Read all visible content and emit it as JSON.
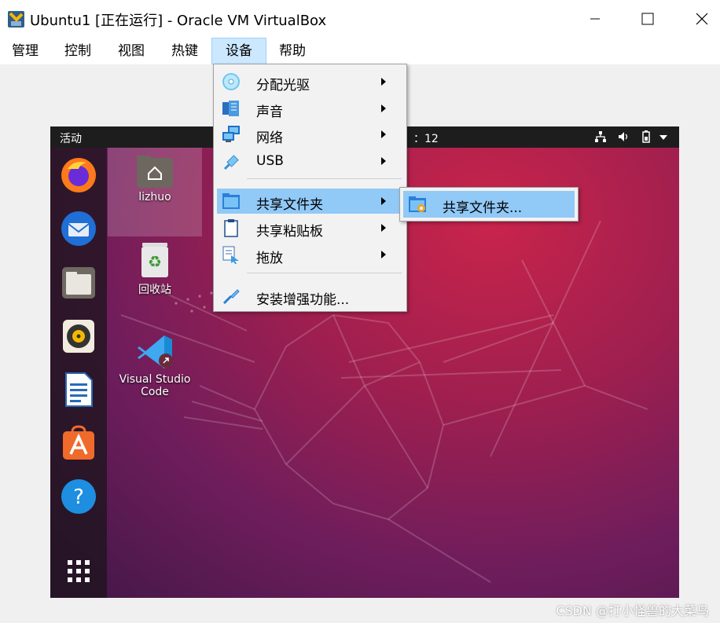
{
  "window": {
    "title": "Ubuntu1 [正在运行] - Oracle VM VirtualBox",
    "controls": [
      "minimize",
      "maximize",
      "close"
    ]
  },
  "menubar": {
    "items": [
      {
        "label": "管理"
      },
      {
        "label": "控制"
      },
      {
        "label": "视图"
      },
      {
        "label": "热键"
      },
      {
        "label": "设备",
        "active": true
      },
      {
        "label": "帮助"
      }
    ]
  },
  "devices_menu": {
    "items": [
      {
        "label": "分配光驱",
        "icon": "optical-disc-icon",
        "submenu": true
      },
      {
        "label": "声音",
        "icon": "audio-icon",
        "submenu": true
      },
      {
        "label": "网络",
        "icon": "network-icon",
        "submenu": true
      },
      {
        "label": "USB",
        "icon": "usb-icon",
        "submenu": true
      },
      {
        "label": "共享文件夹",
        "icon": "shared-folder-icon",
        "submenu": true,
        "highlighted": true
      },
      {
        "label": "共享粘贴板",
        "icon": "clipboard-icon",
        "submenu": true
      },
      {
        "label": "拖放",
        "icon": "drag-drop-icon",
        "submenu": true
      },
      {
        "label": "安装增强功能...",
        "icon": "guest-additions-icon",
        "submenu": false
      }
    ]
  },
  "shared_folder_submenu": {
    "items": [
      {
        "label": "共享文件夹...",
        "icon": "shared-folder-settings-icon",
        "highlighted": true
      }
    ]
  },
  "guest": {
    "topbar": {
      "activities": "活动",
      "clock_fragment": "：12",
      "status_icons": [
        "network-wired-icon",
        "volume-icon",
        "battery-icon",
        "system-menu-arrow-icon"
      ]
    },
    "dock": {
      "items": [
        {
          "name": "firefox-icon"
        },
        {
          "name": "thunderbird-icon"
        },
        {
          "name": "files-icon"
        },
        {
          "name": "rhythmbox-icon"
        },
        {
          "name": "libreoffice-writer-icon"
        },
        {
          "name": "ubuntu-software-icon"
        },
        {
          "name": "help-icon"
        },
        {
          "name": "show-applications-icon"
        }
      ]
    },
    "desktop_icons": [
      {
        "label": "lizhuo",
        "icon": "home-folder-icon"
      },
      {
        "label": "回收站",
        "icon": "trash-icon"
      },
      {
        "label": "Visual Studio Code",
        "line1": "Visual Studio",
        "line2": "Code",
        "icon": "vscode-icon"
      }
    ]
  },
  "watermark": "CSDN @打小怪兽的大菜鸟",
  "colors": {
    "menu_highlight": "#91c9f7",
    "menubar_active": "#cce8ff",
    "ubuntu_wallpaper": "#9e1f4f"
  }
}
